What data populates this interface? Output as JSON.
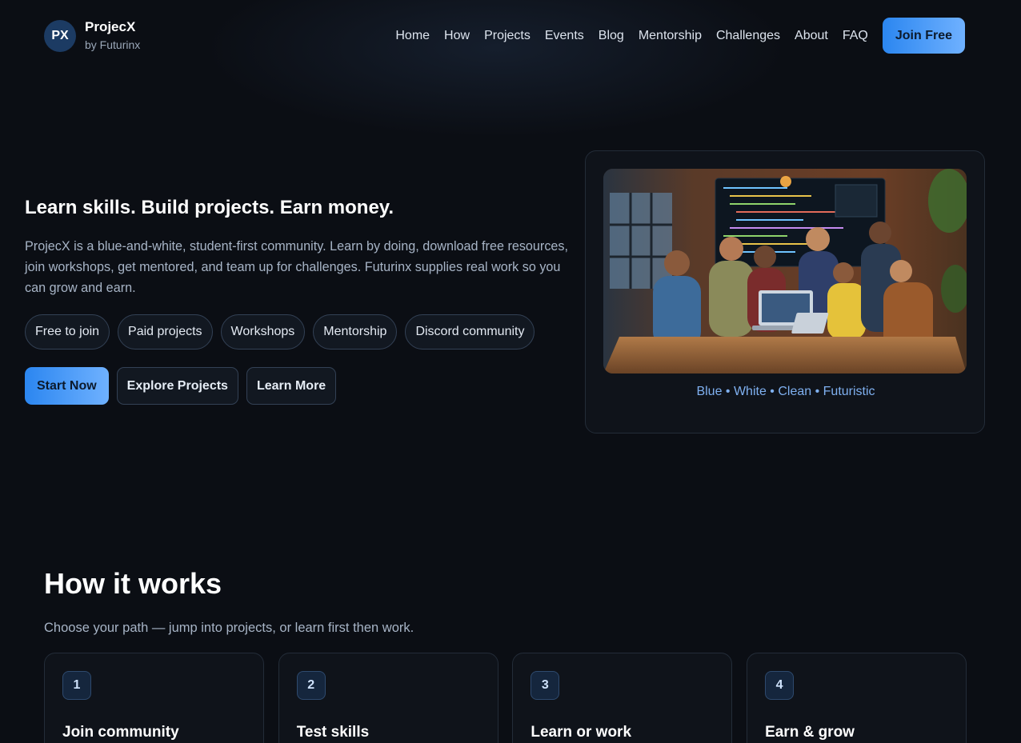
{
  "brand": {
    "logo": "PX",
    "name": "ProjecX",
    "subtitle": "by Futurinx"
  },
  "nav": {
    "links": [
      "Home",
      "How",
      "Projects",
      "Events",
      "Blog",
      "Mentorship",
      "Challenges",
      "About",
      "FAQ"
    ],
    "cta": "Join Free"
  },
  "hero": {
    "title": "Learn skills. Build projects. Earn money.",
    "description": "ProjecX is a blue-and-white, student-first community. Learn by doing, download free resources, join workshops, get mentored, and team up for challenges. Futurinx supplies real work so you can grow and earn.",
    "chips": [
      "Free to join",
      "Paid projects",
      "Workshops",
      "Mentorship",
      "Discord community"
    ],
    "buttons": {
      "primary": "Start Now",
      "explore": "Explore Projects",
      "learn": "Learn More"
    },
    "image_alt": "team-collaborating-photo",
    "caption": "Blue • White • Clean • Futuristic"
  },
  "how": {
    "title": "How it works",
    "subtitle": "Choose your path — jump into projects, or learn first then work.",
    "steps": [
      {
        "num": "1",
        "title": "Join community"
      },
      {
        "num": "2",
        "title": "Test skills"
      },
      {
        "num": "3",
        "title": "Learn or work"
      },
      {
        "num": "4",
        "title": "Earn & grow"
      }
    ]
  },
  "colors": {
    "accent": "#2b86f0",
    "accent_light": "#6fb1ff",
    "background": "#0b0e14",
    "caption": "#7fb0f0"
  }
}
